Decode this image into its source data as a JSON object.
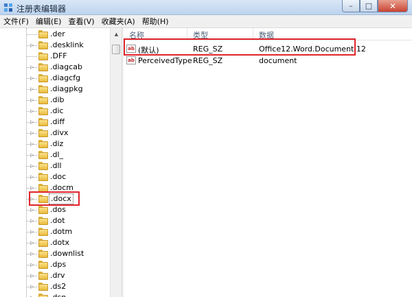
{
  "window": {
    "title": "注册表编辑器",
    "min_glyph": "–",
    "max_glyph": "□",
    "close_glyph": "✕"
  },
  "menu": [
    {
      "label": "文件(F)"
    },
    {
      "label": "编辑(E)"
    },
    {
      "label": "查看(V)"
    },
    {
      "label": "收藏夹(A)"
    },
    {
      "label": "帮助(H)"
    }
  ],
  "tree": {
    "selected": ".docx",
    "items": [
      {
        "label": ".der",
        "expandable": false
      },
      {
        "label": ".desklink",
        "expandable": true
      },
      {
        "label": ".DFF",
        "expandable": false
      },
      {
        "label": ".diagcab",
        "expandable": true
      },
      {
        "label": ".diagcfg",
        "expandable": true
      },
      {
        "label": ".diagpkg",
        "expandable": true
      },
      {
        "label": ".dib",
        "expandable": true
      },
      {
        "label": ".dic",
        "expandable": true
      },
      {
        "label": ".diff",
        "expandable": true
      },
      {
        "label": ".divx",
        "expandable": true
      },
      {
        "label": ".diz",
        "expandable": true
      },
      {
        "label": ".dl_",
        "expandable": true
      },
      {
        "label": ".dll",
        "expandable": true
      },
      {
        "label": ".doc",
        "expandable": true
      },
      {
        "label": ".docm",
        "expandable": true
      },
      {
        "label": ".docx",
        "expandable": true
      },
      {
        "label": ".dos",
        "expandable": true
      },
      {
        "label": ".dot",
        "expandable": true
      },
      {
        "label": ".dotm",
        "expandable": true
      },
      {
        "label": ".dotx",
        "expandable": true
      },
      {
        "label": ".downlist",
        "expandable": true
      },
      {
        "label": ".dps",
        "expandable": true
      },
      {
        "label": ".drv",
        "expandable": true
      },
      {
        "label": ".ds2",
        "expandable": true
      },
      {
        "label": ".dsn",
        "expandable": true
      }
    ]
  },
  "list": {
    "columns": [
      {
        "label": "名称"
      },
      {
        "label": "类型"
      },
      {
        "label": "数据"
      }
    ],
    "rows": [
      {
        "name": "(默认)",
        "type": "REG_SZ",
        "data": "Office12.Word.Document.12",
        "icon": "string-value-icon"
      },
      {
        "name": "PerceivedType",
        "type": "REG_SZ",
        "data": "document",
        "icon": "string-value-icon"
      }
    ]
  },
  "colors": {
    "highlight": "#e0242b",
    "titlebar": "#c8daf1",
    "folder": "#f3cc55"
  }
}
